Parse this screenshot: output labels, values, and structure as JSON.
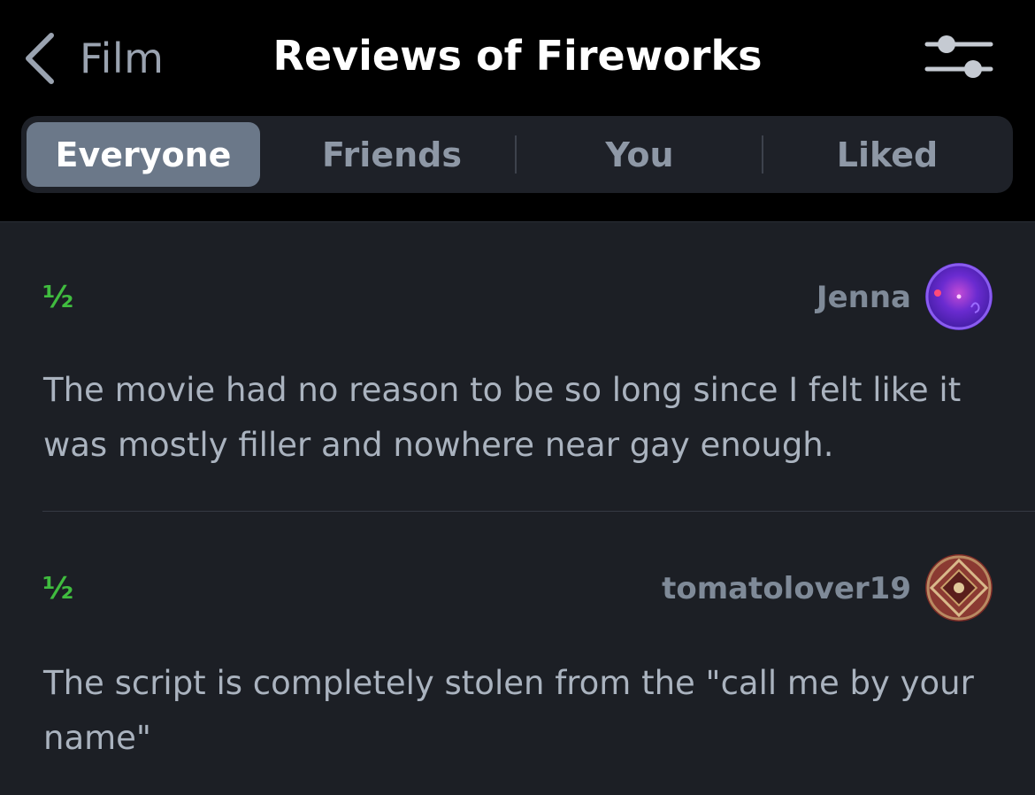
{
  "nav": {
    "back_label": "Film",
    "title": "Reviews of Fireworks",
    "back_icon": "chevron-left-icon",
    "filter_icon": "sliders-icon"
  },
  "tabs": [
    {
      "label": "Everyone",
      "active": true
    },
    {
      "label": "Friends",
      "active": false
    },
    {
      "label": "You",
      "active": false
    },
    {
      "label": "Liked",
      "active": false
    }
  ],
  "reviews": [
    {
      "rating": "½",
      "username": "Jenna",
      "text": "The movie had no reason to be so long since I felt like it was mostly filler and nowhere near gay enough."
    },
    {
      "rating": "½",
      "username": "tomatolover19",
      "text": "The script is completely stolen from the \"call me by your name\""
    }
  ],
  "colors": {
    "header_bg": "#000000",
    "page_bg": "#1c1f25",
    "rating_green": "#40bc3f",
    "active_tab": "#6b7889"
  }
}
